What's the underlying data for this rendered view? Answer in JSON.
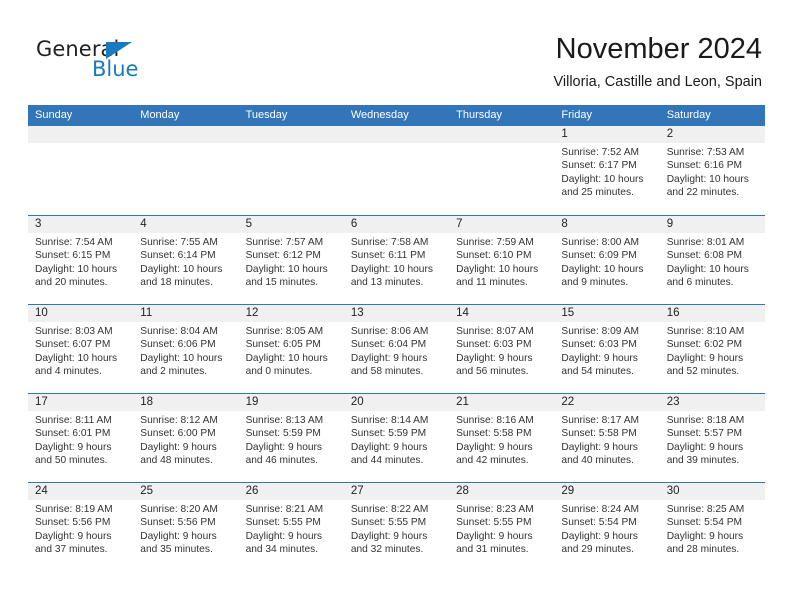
{
  "brand": {
    "name_part1": "General",
    "name_part2": "Blue",
    "accent_color": "#1a7ac0",
    "triangle_icon": "brand-triangle-icon"
  },
  "header": {
    "title": "November 2024",
    "subtitle": "Villoria, Castille and Leon, Spain"
  },
  "calendar": {
    "header_bg": "#3275b8",
    "daynum_bg": "#f0f0f0",
    "weekdays": [
      "Sunday",
      "Monday",
      "Tuesday",
      "Wednesday",
      "Thursday",
      "Friday",
      "Saturday"
    ],
    "weeks": [
      [
        {
          "day": "",
          "sunrise": "",
          "sunset": "",
          "daylight_line1": "",
          "daylight_line2": ""
        },
        {
          "day": "",
          "sunrise": "",
          "sunset": "",
          "daylight_line1": "",
          "daylight_line2": ""
        },
        {
          "day": "",
          "sunrise": "",
          "sunset": "",
          "daylight_line1": "",
          "daylight_line2": ""
        },
        {
          "day": "",
          "sunrise": "",
          "sunset": "",
          "daylight_line1": "",
          "daylight_line2": ""
        },
        {
          "day": "",
          "sunrise": "",
          "sunset": "",
          "daylight_line1": "",
          "daylight_line2": ""
        },
        {
          "day": "1",
          "sunrise": "Sunrise: 7:52 AM",
          "sunset": "Sunset: 6:17 PM",
          "daylight_line1": "Daylight: 10 hours",
          "daylight_line2": "and 25 minutes."
        },
        {
          "day": "2",
          "sunrise": "Sunrise: 7:53 AM",
          "sunset": "Sunset: 6:16 PM",
          "daylight_line1": "Daylight: 10 hours",
          "daylight_line2": "and 22 minutes."
        }
      ],
      [
        {
          "day": "3",
          "sunrise": "Sunrise: 7:54 AM",
          "sunset": "Sunset: 6:15 PM",
          "daylight_line1": "Daylight: 10 hours",
          "daylight_line2": "and 20 minutes."
        },
        {
          "day": "4",
          "sunrise": "Sunrise: 7:55 AM",
          "sunset": "Sunset: 6:14 PM",
          "daylight_line1": "Daylight: 10 hours",
          "daylight_line2": "and 18 minutes."
        },
        {
          "day": "5",
          "sunrise": "Sunrise: 7:57 AM",
          "sunset": "Sunset: 6:12 PM",
          "daylight_line1": "Daylight: 10 hours",
          "daylight_line2": "and 15 minutes."
        },
        {
          "day": "6",
          "sunrise": "Sunrise: 7:58 AM",
          "sunset": "Sunset: 6:11 PM",
          "daylight_line1": "Daylight: 10 hours",
          "daylight_line2": "and 13 minutes."
        },
        {
          "day": "7",
          "sunrise": "Sunrise: 7:59 AM",
          "sunset": "Sunset: 6:10 PM",
          "daylight_line1": "Daylight: 10 hours",
          "daylight_line2": "and 11 minutes."
        },
        {
          "day": "8",
          "sunrise": "Sunrise: 8:00 AM",
          "sunset": "Sunset: 6:09 PM",
          "daylight_line1": "Daylight: 10 hours",
          "daylight_line2": "and 9 minutes."
        },
        {
          "day": "9",
          "sunrise": "Sunrise: 8:01 AM",
          "sunset": "Sunset: 6:08 PM",
          "daylight_line1": "Daylight: 10 hours",
          "daylight_line2": "and 6 minutes."
        }
      ],
      [
        {
          "day": "10",
          "sunrise": "Sunrise: 8:03 AM",
          "sunset": "Sunset: 6:07 PM",
          "daylight_line1": "Daylight: 10 hours",
          "daylight_line2": "and 4 minutes."
        },
        {
          "day": "11",
          "sunrise": "Sunrise: 8:04 AM",
          "sunset": "Sunset: 6:06 PM",
          "daylight_line1": "Daylight: 10 hours",
          "daylight_line2": "and 2 minutes."
        },
        {
          "day": "12",
          "sunrise": "Sunrise: 8:05 AM",
          "sunset": "Sunset: 6:05 PM",
          "daylight_line1": "Daylight: 10 hours",
          "daylight_line2": "and 0 minutes."
        },
        {
          "day": "13",
          "sunrise": "Sunrise: 8:06 AM",
          "sunset": "Sunset: 6:04 PM",
          "daylight_line1": "Daylight: 9 hours",
          "daylight_line2": "and 58 minutes."
        },
        {
          "day": "14",
          "sunrise": "Sunrise: 8:07 AM",
          "sunset": "Sunset: 6:03 PM",
          "daylight_line1": "Daylight: 9 hours",
          "daylight_line2": "and 56 minutes."
        },
        {
          "day": "15",
          "sunrise": "Sunrise: 8:09 AM",
          "sunset": "Sunset: 6:03 PM",
          "daylight_line1": "Daylight: 9 hours",
          "daylight_line2": "and 54 minutes."
        },
        {
          "day": "16",
          "sunrise": "Sunrise: 8:10 AM",
          "sunset": "Sunset: 6:02 PM",
          "daylight_line1": "Daylight: 9 hours",
          "daylight_line2": "and 52 minutes."
        }
      ],
      [
        {
          "day": "17",
          "sunrise": "Sunrise: 8:11 AM",
          "sunset": "Sunset: 6:01 PM",
          "daylight_line1": "Daylight: 9 hours",
          "daylight_line2": "and 50 minutes."
        },
        {
          "day": "18",
          "sunrise": "Sunrise: 8:12 AM",
          "sunset": "Sunset: 6:00 PM",
          "daylight_line1": "Daylight: 9 hours",
          "daylight_line2": "and 48 minutes."
        },
        {
          "day": "19",
          "sunrise": "Sunrise: 8:13 AM",
          "sunset": "Sunset: 5:59 PM",
          "daylight_line1": "Daylight: 9 hours",
          "daylight_line2": "and 46 minutes."
        },
        {
          "day": "20",
          "sunrise": "Sunrise: 8:14 AM",
          "sunset": "Sunset: 5:59 PM",
          "daylight_line1": "Daylight: 9 hours",
          "daylight_line2": "and 44 minutes."
        },
        {
          "day": "21",
          "sunrise": "Sunrise: 8:16 AM",
          "sunset": "Sunset: 5:58 PM",
          "daylight_line1": "Daylight: 9 hours",
          "daylight_line2": "and 42 minutes."
        },
        {
          "day": "22",
          "sunrise": "Sunrise: 8:17 AM",
          "sunset": "Sunset: 5:58 PM",
          "daylight_line1": "Daylight: 9 hours",
          "daylight_line2": "and 40 minutes."
        },
        {
          "day": "23",
          "sunrise": "Sunrise: 8:18 AM",
          "sunset": "Sunset: 5:57 PM",
          "daylight_line1": "Daylight: 9 hours",
          "daylight_line2": "and 39 minutes."
        }
      ],
      [
        {
          "day": "24",
          "sunrise": "Sunrise: 8:19 AM",
          "sunset": "Sunset: 5:56 PM",
          "daylight_line1": "Daylight: 9 hours",
          "daylight_line2": "and 37 minutes."
        },
        {
          "day": "25",
          "sunrise": "Sunrise: 8:20 AM",
          "sunset": "Sunset: 5:56 PM",
          "daylight_line1": "Daylight: 9 hours",
          "daylight_line2": "and 35 minutes."
        },
        {
          "day": "26",
          "sunrise": "Sunrise: 8:21 AM",
          "sunset": "Sunset: 5:55 PM",
          "daylight_line1": "Daylight: 9 hours",
          "daylight_line2": "and 34 minutes."
        },
        {
          "day": "27",
          "sunrise": "Sunrise: 8:22 AM",
          "sunset": "Sunset: 5:55 PM",
          "daylight_line1": "Daylight: 9 hours",
          "daylight_line2": "and 32 minutes."
        },
        {
          "day": "28",
          "sunrise": "Sunrise: 8:23 AM",
          "sunset": "Sunset: 5:55 PM",
          "daylight_line1": "Daylight: 9 hours",
          "daylight_line2": "and 31 minutes."
        },
        {
          "day": "29",
          "sunrise": "Sunrise: 8:24 AM",
          "sunset": "Sunset: 5:54 PM",
          "daylight_line1": "Daylight: 9 hours",
          "daylight_line2": "and 29 minutes."
        },
        {
          "day": "30",
          "sunrise": "Sunrise: 8:25 AM",
          "sunset": "Sunset: 5:54 PM",
          "daylight_line1": "Daylight: 9 hours",
          "daylight_line2": "and 28 minutes."
        }
      ]
    ]
  }
}
